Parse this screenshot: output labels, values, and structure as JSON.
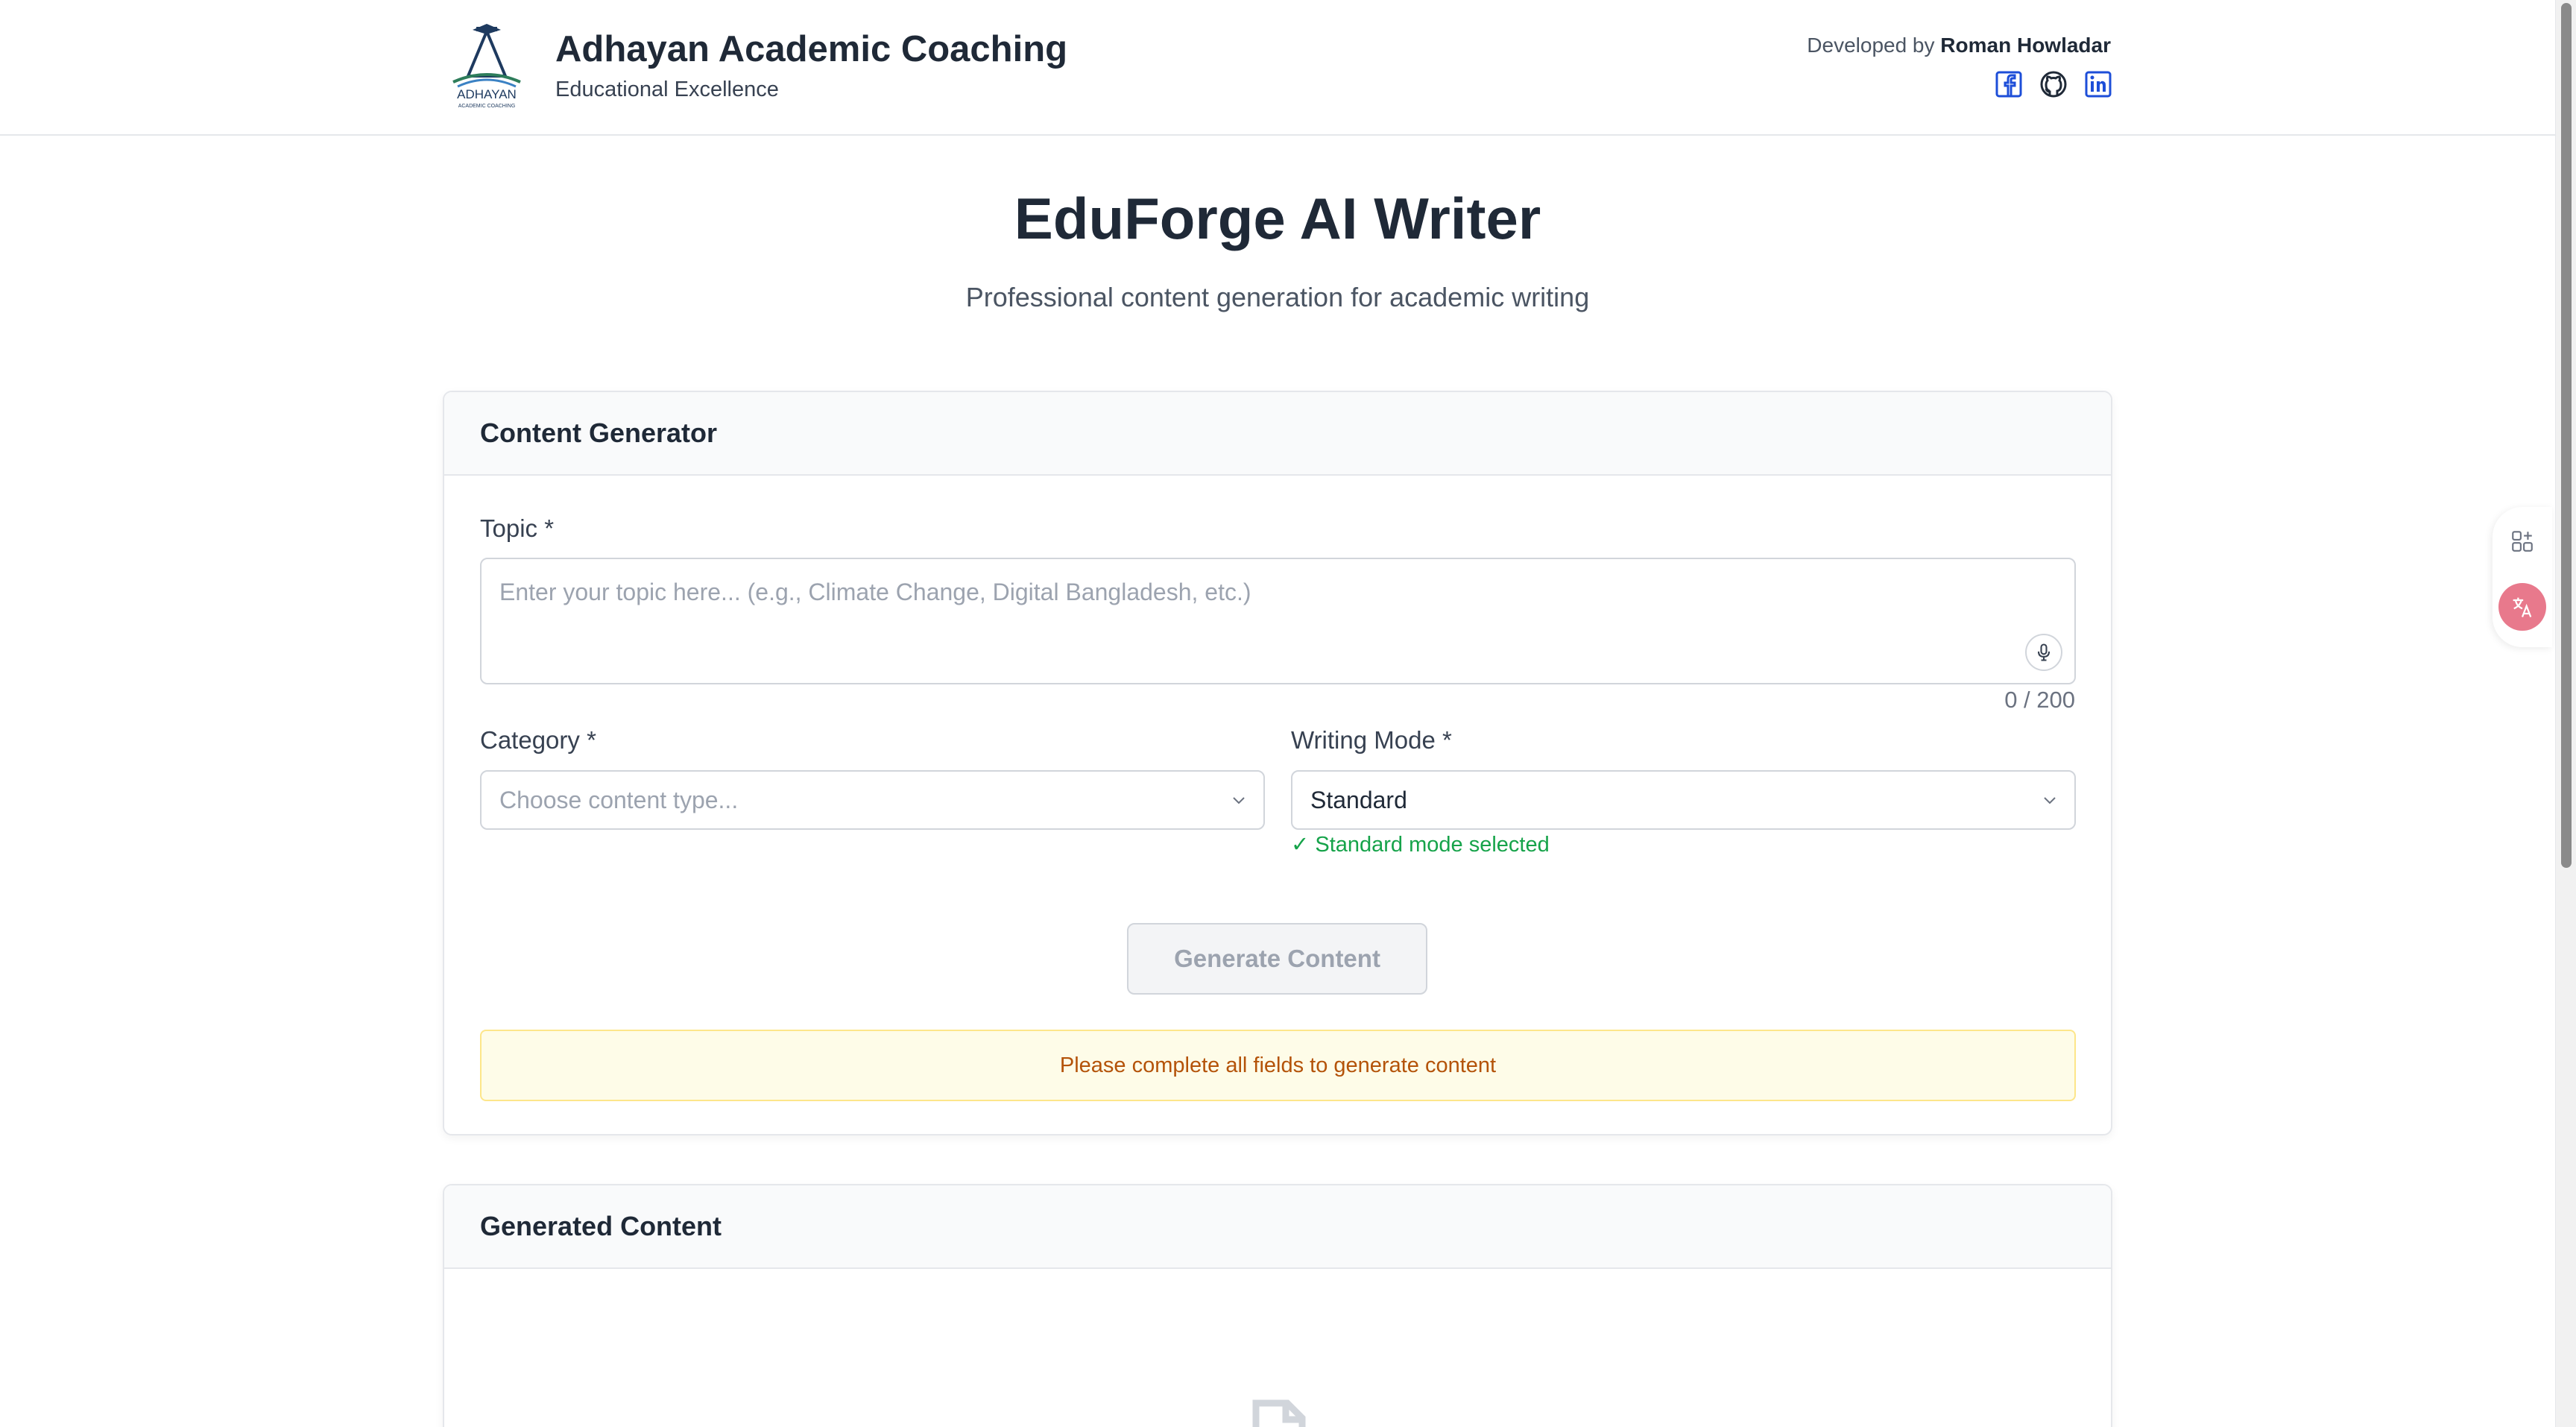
{
  "header": {
    "brand_title": "Adhayan Academic Coaching",
    "brand_subtitle": "Educational Excellence",
    "logo_text": "ADHAYAN",
    "logo_subtext": "ACADEMIC COACHING",
    "developer_prefix": "Developed by",
    "developer_name": "Roman Howladar",
    "social_icons": [
      "facebook-icon",
      "github-icon",
      "linkedin-icon"
    ]
  },
  "hero": {
    "title": "EduForge AI Writer",
    "subtitle": "Professional content generation for academic writing"
  },
  "generator": {
    "title": "Content Generator",
    "topic_label": "Topic *",
    "topic_placeholder": "Enter your topic here... (e.g., Climate Change, Digital Bangladesh, etc.)",
    "topic_value": "",
    "char_counter": "0 / 200",
    "category_label": "Category *",
    "category_placeholder": "Choose content type...",
    "mode_label": "Writing Mode *",
    "mode_value": "Standard",
    "mode_status": "✓ Standard mode selected",
    "generate_label": "Generate Content",
    "warning": "Please complete all fields to generate content"
  },
  "output": {
    "title": "Generated Content"
  },
  "colors": {
    "success": "#16a34a",
    "warning_text": "#b45309",
    "warning_bg": "#fefce8",
    "social_blue": "#1d4ed8",
    "translate_pink": "#e8798c"
  }
}
